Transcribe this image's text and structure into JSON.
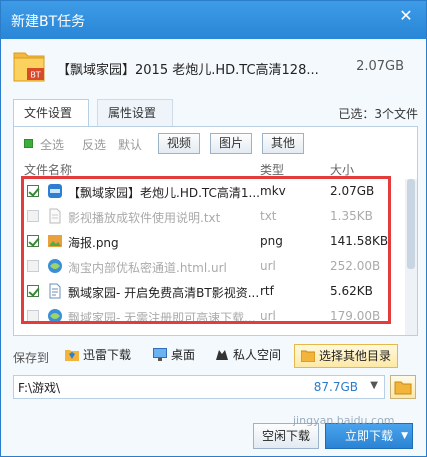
{
  "window": {
    "title": "新建BT任务",
    "close_glyph": "✕"
  },
  "task": {
    "name": "【飘域家园】2015 老炮儿.HD.TC高清128...",
    "size": "2.07GB",
    "folder_badge": "BT"
  },
  "tabs": [
    {
      "label": "文件设置"
    },
    {
      "label": "属性设置"
    }
  ],
  "selected_info": "已选：3个文件",
  "filters": {
    "all": "全选",
    "invert": "反选",
    "default": "默认",
    "video": "视频",
    "image": "图片",
    "other": "其他"
  },
  "columns": {
    "name": "文件名称",
    "type": "类型",
    "size": "大小"
  },
  "files": [
    {
      "name": "【飘域家园】老炮儿.HD.TC高清1...",
      "type": "mkv",
      "size": "2.07GB",
      "checked": true,
      "icon": "video-file-icon"
    },
    {
      "name": "影视播放成软件使用说明.txt",
      "type": "txt",
      "size": "1.35KB",
      "checked": false,
      "icon": "text-file-icon"
    },
    {
      "name": "海报.png",
      "type": "png",
      "size": "141.58KB",
      "checked": true,
      "icon": "image-file-icon"
    },
    {
      "name": "淘宝内部优私密通道.html.url",
      "type": "url",
      "size": "252.00B",
      "checked": false,
      "icon": "url-file-icon"
    },
    {
      "name": "飘域家园- 开启免费高清BT影视资...",
      "type": "rtf",
      "size": "5.62KB",
      "checked": true,
      "icon": "rtf-file-icon"
    },
    {
      "name": "飘域家园- 无需注册即可高速下载...",
      "type": "url",
      "size": "179.00B",
      "checked": false,
      "icon": "url-file-icon"
    }
  ],
  "save": {
    "label": "保存到",
    "options": [
      {
        "label": "迅雷下载",
        "icon": "folder-icon"
      },
      {
        "label": "桌面",
        "icon": "desktop-icon"
      },
      {
        "label": "私人空间",
        "icon": "private-space-icon"
      },
      {
        "label": "选择其他目录",
        "icon": "folder-browse-icon"
      }
    ],
    "path": "F:\\游戏\\",
    "free_space": "87.7GB"
  },
  "footer": {
    "free_download": "空闲下载",
    "download_now": "立即下载"
  },
  "watermark": "jingyan.baidu.com",
  "colors": {
    "accent": "#2b7cc9",
    "highlight_border": "#e33c3c",
    "check_green": "#2e8b2e"
  }
}
